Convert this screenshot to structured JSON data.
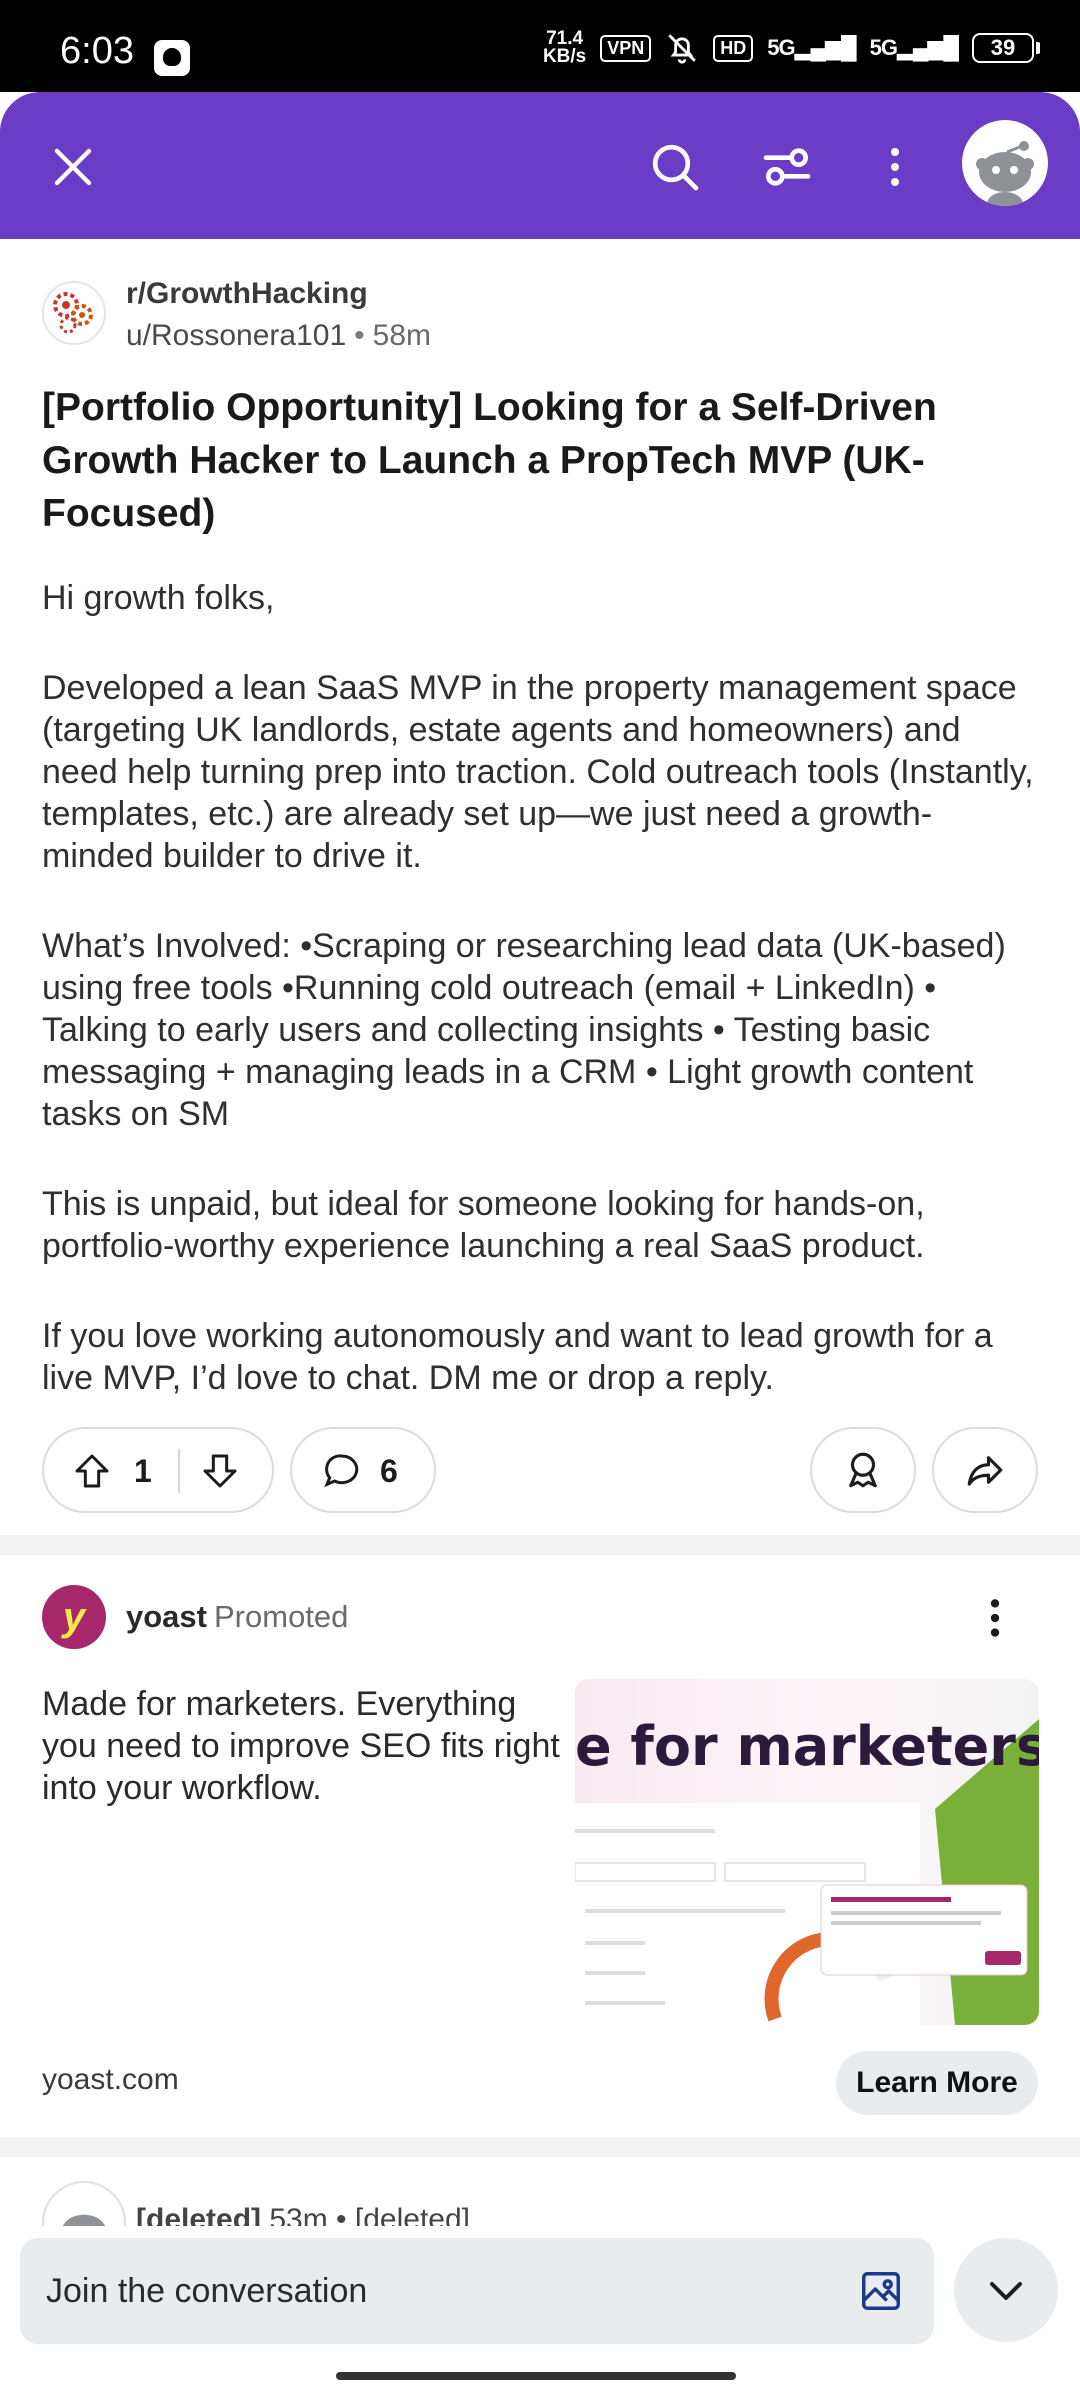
{
  "status_bar": {
    "time": "6:03",
    "net_speed_value": "71.4",
    "net_speed_unit": "KB/s",
    "vpn": "VPN",
    "hd": "HD",
    "net1": "5G",
    "net2": "5G",
    "battery": "39"
  },
  "header": {
    "icons": [
      "close-icon",
      "search-icon",
      "filter-icon",
      "more-vertical-icon",
      "avatar"
    ],
    "accent_color": "#6b3cc6"
  },
  "post": {
    "subreddit": "r/GrowthHacking",
    "author": "u/Rossonera101",
    "separator": "•",
    "age": "58m",
    "title": "[Portfolio Opportunity] Looking for a Self-Driven Growth Hacker to Launch a PropTech MVP (UK-Focused)",
    "body": [
      "Hi growth folks,",
      "Developed a lean SaaS MVP in the property management space (targeting UK landlords, estate agents and homeowners) and need help turning prep into traction. Cold outreach tools (Instantly, templates, etc.) are already set up—we just need a growth-minded builder to drive it.",
      "What’s Involved: •Scraping or researching lead data (UK-based) using free tools •Running cold outreach (email + LinkedIn) • Talking to early users and collecting insights • Testing basic messaging + managing leads in a CRM • Light growth content tasks on SM",
      "This is unpaid, but ideal for someone looking for hands-on, portfolio-worthy experience launching a real SaaS product.",
      "If you love working autonomously and want to lead growth for a live MVP, I’d love to chat. DM me or drop a reply."
    ],
    "votes": "1",
    "comments": "6"
  },
  "ad": {
    "avatar_letter": "y",
    "brand": "yoast",
    "promoted": "Promoted",
    "text": "Made for marketers. Everything you need to improve SEO fits right into your workflow.",
    "image_headline": "e for marketers",
    "domain": "yoast.com",
    "cta": "Learn More"
  },
  "next_comment": {
    "user": "[deleted]",
    "age": "53m",
    "text": "[deleted]"
  },
  "composer": {
    "placeholder": "Join the conversation"
  }
}
